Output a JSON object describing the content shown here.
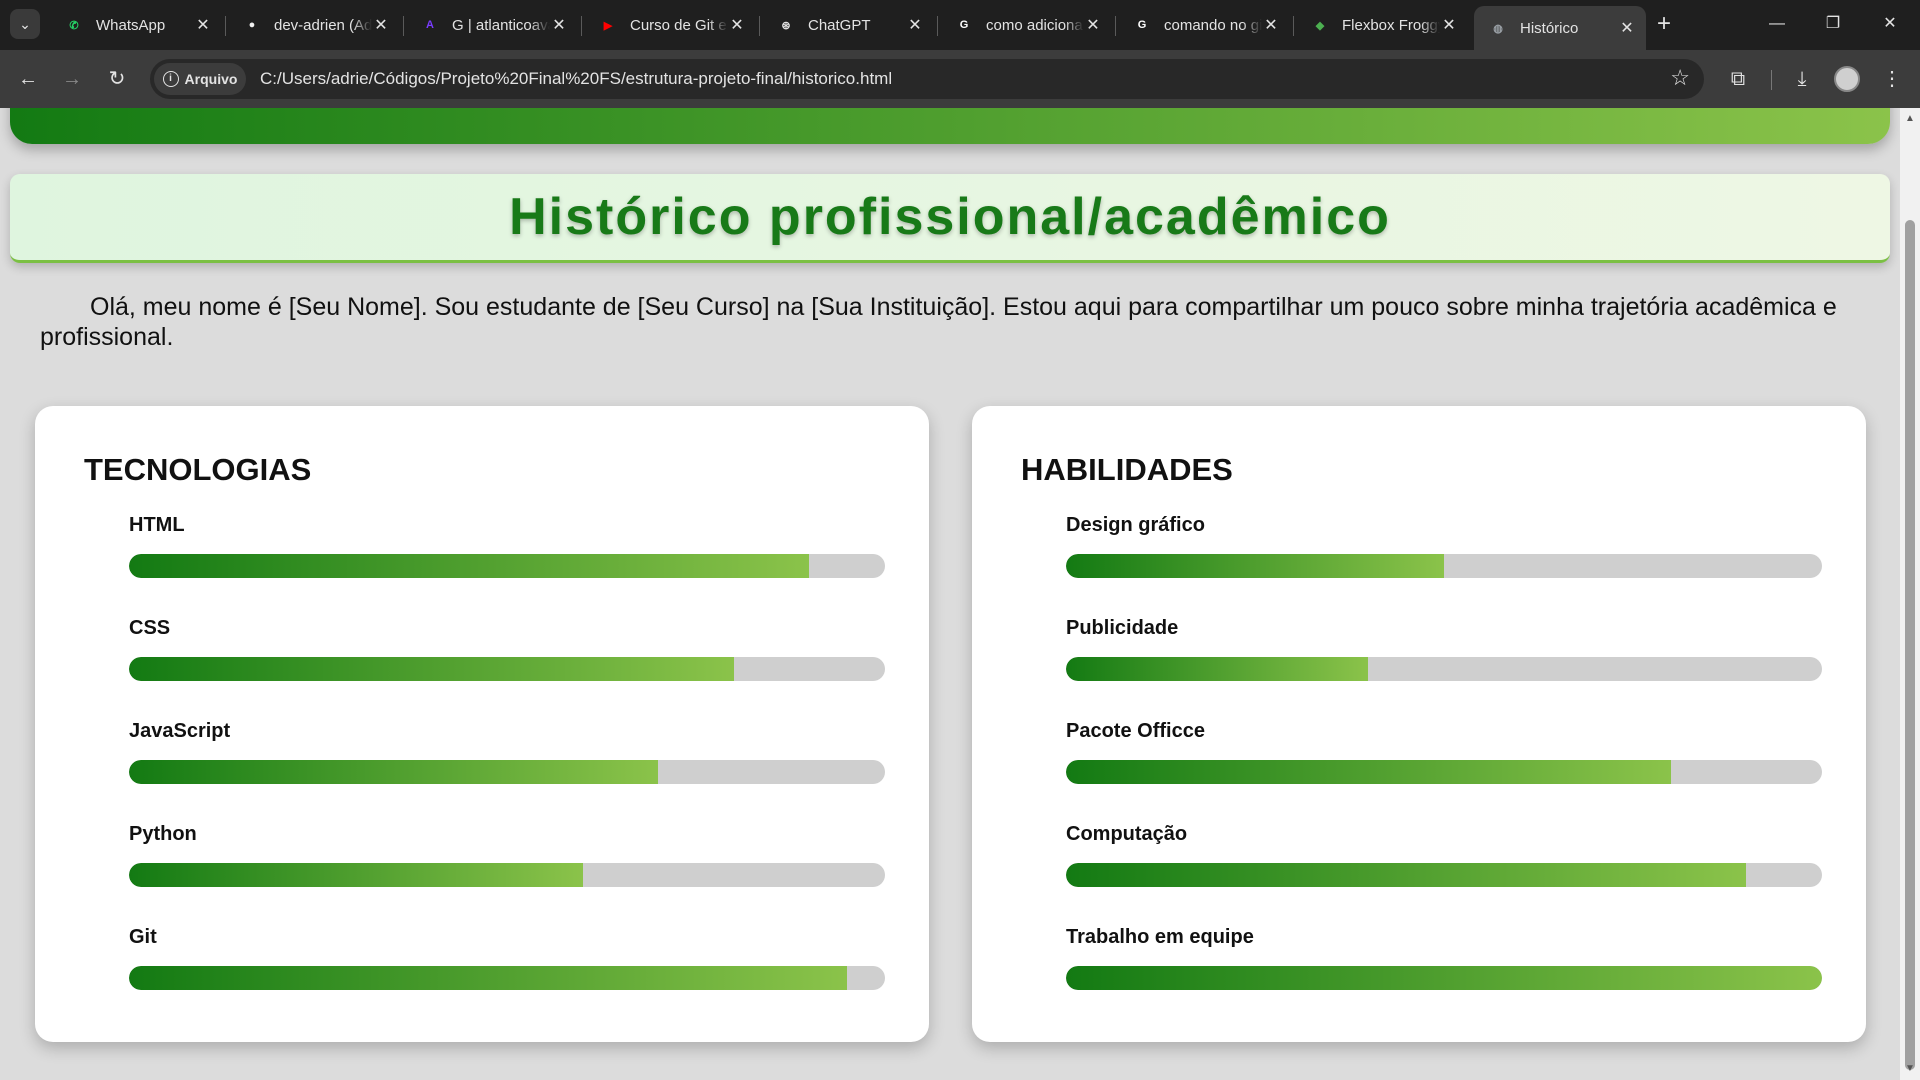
{
  "browser": {
    "tabs": [
      {
        "title": "WhatsApp",
        "icon": "whatsapp-icon",
        "color": "#25d366",
        "glyph": "✆",
        "active": false
      },
      {
        "title": "dev-adrien (Adrien)",
        "icon": "github-icon",
        "color": "#f0f0f0",
        "glyph": "●",
        "active": false
      },
      {
        "title": "G | atlanticoavanti",
        "icon": "atlantico-icon",
        "color": "#7a3cff",
        "glyph": "A",
        "active": false
      },
      {
        "title": "Curso de Git e GitHub",
        "icon": "youtube-icon",
        "color": "#ff0000",
        "glyph": "▶",
        "active": false
      },
      {
        "title": "ChatGPT",
        "icon": "chatgpt-icon",
        "color": "#e3e3e3",
        "glyph": "⊛",
        "active": false
      },
      {
        "title": "como adicionar",
        "icon": "google-icon",
        "color": "#ffffff",
        "glyph": "G",
        "active": false
      },
      {
        "title": "comando no git",
        "icon": "google-icon",
        "color": "#ffffff",
        "glyph": "G",
        "active": false
      },
      {
        "title": "Flexbox Froggy",
        "icon": "frog-icon",
        "color": "#4caf50",
        "glyph": "◆",
        "active": false
      },
      {
        "title": "Histórico",
        "icon": "globe-icon",
        "color": "#9aa0a6",
        "glyph": "◍",
        "active": true
      }
    ],
    "site_chip": "Arquivo",
    "url": "C:/Users/adrie/Códigos/Projeto%20Final%20FS/estrutura-projeto-final/historico.html"
  },
  "page": {
    "title": "Histórico profissional/acadêmico",
    "intro": "Olá, meu nome é [Seu Nome]. Sou estudante de [Seu Curso] na [Sua Instituição]. Estou aqui para compartilhar um pouco sobre minha trajetória acadêmica e profissional.",
    "technologies": {
      "title": "TECNOLOGIAS",
      "items": [
        {
          "label": "HTML",
          "level": 0.9
        },
        {
          "label": "CSS",
          "level": 0.8
        },
        {
          "label": "JavaScript",
          "level": 0.7
        },
        {
          "label": "Python",
          "level": 0.6
        },
        {
          "label": "Git",
          "level": 0.95
        }
      ]
    },
    "skills": {
      "title": "HABILIDADES",
      "items": [
        {
          "label": "Design gráfico",
          "level": 0.5
        },
        {
          "label": "Publicidade",
          "level": 0.4
        },
        {
          "label": "Pacote Officce",
          "level": 0.8
        },
        {
          "label": "Computação",
          "level": 0.9
        },
        {
          "label": "Trabalho em equipe",
          "level": 1.0
        }
      ]
    }
  },
  "colors": {
    "bar_start": "#137a13",
    "bar_end": "#8bc34a",
    "title_green": "#187a18"
  }
}
